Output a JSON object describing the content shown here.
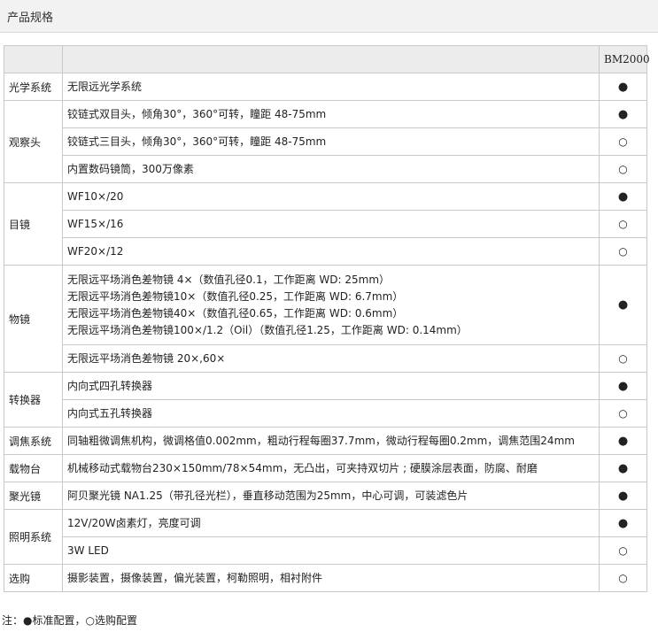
{
  "page_title": "产品规格",
  "table": {
    "header": {
      "col1": "",
      "col2": "",
      "model": "BM2000"
    },
    "symbols": {
      "standard": "●",
      "optional": "○"
    },
    "groups": [
      {
        "category": "光学系统",
        "rows": [
          {
            "lines": [
              "无限远光学系统"
            ],
            "type": "standard"
          }
        ]
      },
      {
        "category": "观察头",
        "rows": [
          {
            "lines": [
              "铰链式双目头，倾角30°，360°可转，瞳距 48-75mm"
            ],
            "type": "standard"
          },
          {
            "lines": [
              "铰链式三目头，倾角30°，360°可转，瞳距 48-75mm"
            ],
            "type": "optional"
          },
          {
            "lines": [
              "内置数码镜筒，300万像素"
            ],
            "type": "optional"
          }
        ]
      },
      {
        "category": "目镜",
        "rows": [
          {
            "lines": [
              "WF10×/20"
            ],
            "type": "standard"
          },
          {
            "lines": [
              "WF15×/16"
            ],
            "type": "optional"
          },
          {
            "lines": [
              "WF20×/12"
            ],
            "type": "optional"
          }
        ]
      },
      {
        "category": "物镜",
        "rows": [
          {
            "lines": [
              "无限远平场消色差物镜 4×（数值孔径0.1，工作距离 WD: 25mm）",
              "无限远平场消色差物镜10×（数值孔径0.25，工作距离 WD: 6.7mm）",
              "无限远平场消色差物镜40×（数值孔径0.65，工作距离 WD: 0.6mm）",
              "无限远平场消色差物镜100×/1.2（Oil）（数值孔径1.25，工作距离 WD: 0.14mm）"
            ],
            "type": "standard"
          },
          {
            "lines": [
              "无限远平场消色差物镜 20×,60×"
            ],
            "type": "optional"
          }
        ]
      },
      {
        "category": "转换器",
        "rows": [
          {
            "lines": [
              "内向式四孔转换器"
            ],
            "type": "standard"
          },
          {
            "lines": [
              "内向式五孔转换器"
            ],
            "type": "optional"
          }
        ]
      },
      {
        "category": "调焦系统",
        "rows": [
          {
            "lines": [
              "同轴粗微调焦机构，微调格值0.002mm，粗动行程每圈37.7mm，微动行程每圈0.2mm，调焦范围24mm"
            ],
            "type": "standard"
          }
        ]
      },
      {
        "category": "载物台",
        "rows": [
          {
            "lines": [
              "机械移动式载物台230×150mm/78×54mm，无凸出，可夹持双切片 ; 硬膜涂层表面，防腐、耐磨"
            ],
            "type": "standard"
          }
        ]
      },
      {
        "category": "聚光镜",
        "rows": [
          {
            "lines": [
              "阿贝聚光镜 NA1.25（带孔径光栏），垂直移动范围为25mm，中心可调，可装滤色片"
            ],
            "type": "standard"
          }
        ]
      },
      {
        "category": "照明系统",
        "rows": [
          {
            "lines": [
              "12V/20W卤素灯，亮度可调"
            ],
            "type": "standard"
          },
          {
            "lines": [
              "3W LED"
            ],
            "type": "optional"
          }
        ]
      },
      {
        "category": "选购",
        "rows": [
          {
            "lines": [
              "摄影装置，摄像装置，偏光装置，柯勒照明，相衬附件"
            ],
            "type": "optional"
          }
        ]
      }
    ]
  },
  "note": "注：●标准配置，○选购配置"
}
